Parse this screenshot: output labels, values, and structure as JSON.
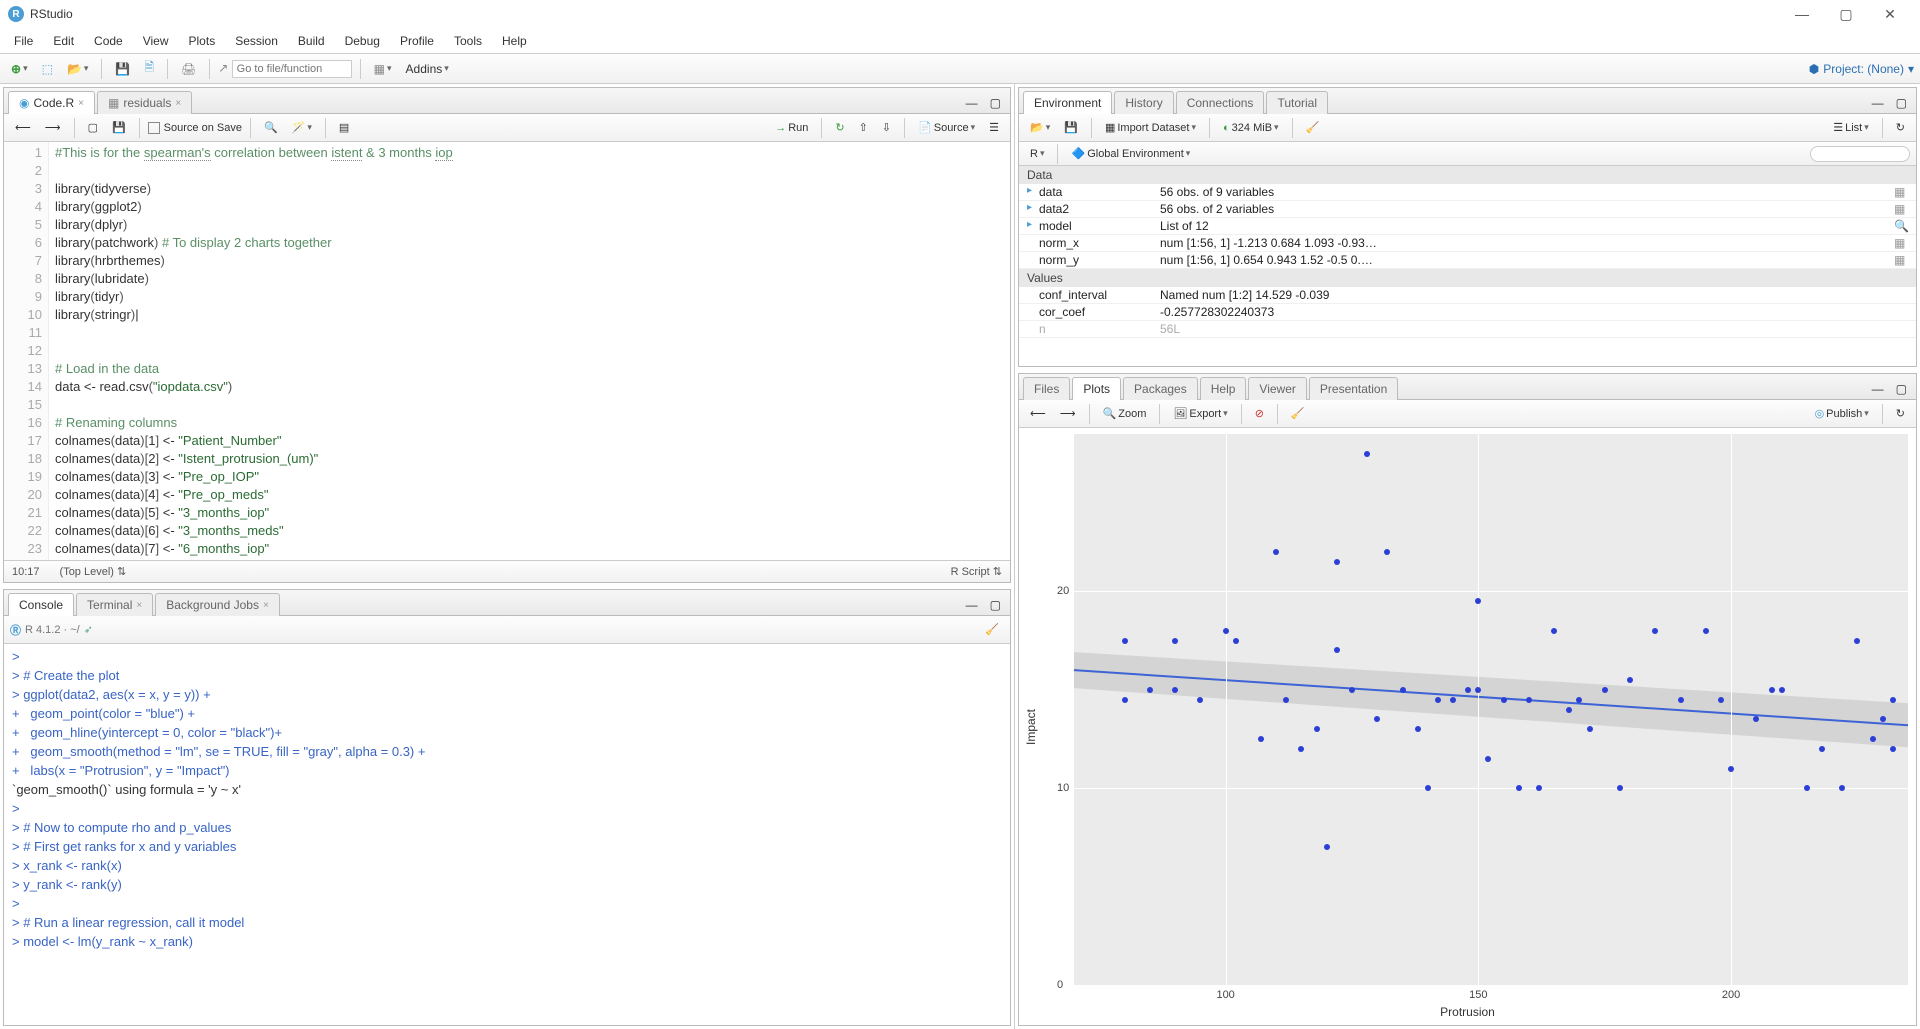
{
  "window": {
    "title": "RStudio"
  },
  "menubar": [
    "File",
    "Edit",
    "Code",
    "View",
    "Plots",
    "Session",
    "Build",
    "Debug",
    "Profile",
    "Tools",
    "Help"
  ],
  "toolbar": {
    "goto_placeholder": "Go to file/function",
    "addins_label": "Addins",
    "project_label": "Project: (None)"
  },
  "source": {
    "tabs": [
      {
        "label": "Code.R",
        "icon": "r-script"
      },
      {
        "label": "residuals",
        "icon": "data"
      }
    ],
    "source_on_save": "Source on Save",
    "run_label": "Run",
    "source_label": "Source",
    "cursor_pos": "10:17",
    "scope": "(Top Level)",
    "filetype": "R Script",
    "lines": [
      {
        "n": 1,
        "html": "<span class='cm-comment'>#This is for the <span class='cm-spell'>spearman's</span> correlation between <span class='cm-spell'>istent</span> &amp; 3 months <span class='cm-spell'>iop</span></span>"
      },
      {
        "n": 2,
        "html": ""
      },
      {
        "n": 3,
        "html": "library<span class='cm-paren'>(</span>tidyverse<span class='cm-paren'>)</span>"
      },
      {
        "n": 4,
        "html": "library<span class='cm-paren'>(</span>ggplot2<span class='cm-paren'>)</span>"
      },
      {
        "n": 5,
        "html": "library<span class='cm-paren'>(</span>dplyr<span class='cm-paren'>)</span>"
      },
      {
        "n": 6,
        "html": "library<span class='cm-paren'>(</span>patchwork<span class='cm-paren'>)</span> <span class='cm-comment'># To display 2 charts together</span>"
      },
      {
        "n": 7,
        "html": "library<span class='cm-paren'>(</span>hrbrthemes<span class='cm-paren'>)</span>"
      },
      {
        "n": 8,
        "html": "library<span class='cm-paren'>(</span>lubridate<span class='cm-paren'>)</span>"
      },
      {
        "n": 9,
        "html": "library<span class='cm-paren'>(</span>tidyr<span class='cm-paren'>)</span>"
      },
      {
        "n": 10,
        "html": "library<span class='cm-paren'>(</span>stringr<span class='cm-paren'>)</span>|"
      },
      {
        "n": 11,
        "html": ""
      },
      {
        "n": 12,
        "html": ""
      },
      {
        "n": 13,
        "html": "<span class='cm-comment'># Load in the data</span>"
      },
      {
        "n": 14,
        "html": "data &lt;- read.csv<span class='cm-paren'>(</span><span class='cm-string'>\"iopdata.csv\"</span><span class='cm-paren'>)</span>"
      },
      {
        "n": 15,
        "html": ""
      },
      {
        "n": 16,
        "html": "<span class='cm-comment'># Renaming columns</span>"
      },
      {
        "n": 17,
        "html": "colnames<span class='cm-paren'>(</span>data<span class='cm-paren'>)[</span>1<span class='cm-paren'>]</span> &lt;- <span class='cm-string'>\"Patient_Number\"</span>"
      },
      {
        "n": 18,
        "html": "colnames<span class='cm-paren'>(</span>data<span class='cm-paren'>)[</span>2<span class='cm-paren'>]</span> &lt;- <span class='cm-string'>\"Istent_protrusion_(um)\"</span>"
      },
      {
        "n": 19,
        "html": "colnames<span class='cm-paren'>(</span>data<span class='cm-paren'>)[</span>3<span class='cm-paren'>]</span> &lt;- <span class='cm-string'>\"Pre_op_IOP\"</span>"
      },
      {
        "n": 20,
        "html": "colnames<span class='cm-paren'>(</span>data<span class='cm-paren'>)[</span>4<span class='cm-paren'>]</span> &lt;- <span class='cm-string'>\"Pre_op_meds\"</span>"
      },
      {
        "n": 21,
        "html": "colnames<span class='cm-paren'>(</span>data<span class='cm-paren'>)[</span>5<span class='cm-paren'>]</span> &lt;- <span class='cm-string'>\"3_months_iop\"</span>"
      },
      {
        "n": 22,
        "html": "colnames<span class='cm-paren'>(</span>data<span class='cm-paren'>)[</span>6<span class='cm-paren'>]</span> &lt;- <span class='cm-string'>\"3_months_meds\"</span>"
      },
      {
        "n": 23,
        "html": "colnames<span class='cm-paren'>(</span>data<span class='cm-paren'>)[</span>7<span class='cm-paren'>]</span> &lt;- <span class='cm-string'>\"6_months_iop\"</span>"
      }
    ]
  },
  "console": {
    "tabs": [
      "Console",
      "Terminal",
      "Background Jobs"
    ],
    "prompt_info": "R 4.1.2 · ~/",
    "lines": [
      ">",
      "> # Create the plot",
      "> ggplot(data2, aes(x = x, y = y)) +",
      "+   geom_point(color = \"blue\") +",
      "+   geom_hline(yintercept = 0, color = \"black\")+",
      "+   geom_smooth(method = \"lm\", se = TRUE, fill = \"gray\", alpha = 0.3) +",
      "+   labs(x = \"Protrusion\", y = \"Impact\")",
      "`geom_smooth()` using formula = 'y ~ x'",
      ">",
      "> # Now to compute rho and p_values",
      "> # First get ranks for x and y variables",
      "> x_rank <- rank(x)",
      "> y_rank <- rank(y)",
      ">",
      "> # Run a linear regression, call it model",
      "> model <- lm(y_rank ~ x_rank)"
    ]
  },
  "env": {
    "tabs": [
      "Environment",
      "History",
      "Connections",
      "Tutorial"
    ],
    "import_label": "Import Dataset",
    "mem_label": "324 MiB",
    "list_label": "List",
    "scope_label": "Global Environment",
    "lang_label": "R",
    "search_placeholder": "",
    "sections": [
      {
        "name": "Data",
        "rows": [
          {
            "name": "data",
            "value": "56 obs. of 9 variables",
            "expandable": true,
            "ico": "grid"
          },
          {
            "name": "data2",
            "value": "56 obs. of 2 variables",
            "expandable": true,
            "ico": "grid"
          },
          {
            "name": "model",
            "value": "List of  12",
            "expandable": true,
            "ico": "search"
          },
          {
            "name": "norm_x",
            "value": "num [1:56, 1] -1.213 0.684 1.093 -0.93…",
            "expandable": false,
            "ico": "grid"
          },
          {
            "name": "norm_y",
            "value": "num [1:56, 1] 0.654 0.943 1.52 -0.5 0.…",
            "expandable": false,
            "ico": "grid"
          }
        ]
      },
      {
        "name": "Values",
        "rows": [
          {
            "name": "conf_interval",
            "value": "Named num [1:2] 14.529 -0.039",
            "expandable": false
          },
          {
            "name": "cor_coef",
            "value": "-0.257728302240373",
            "expandable": false
          },
          {
            "name": "n",
            "value": "56L",
            "expandable": false,
            "dim": true
          }
        ]
      }
    ]
  },
  "plot": {
    "tabs": [
      "Files",
      "Plots",
      "Packages",
      "Help",
      "Viewer",
      "Presentation"
    ],
    "zoom_label": "Zoom",
    "export_label": "Export",
    "publish_label": "Publish",
    "xlabel": "Protrusion",
    "ylabel": "Impact",
    "xticks": [
      100,
      150,
      200
    ],
    "yticks": [
      0,
      10,
      20
    ]
  },
  "chart_data": {
    "type": "scatter",
    "title": "",
    "xlabel": "Protrusion",
    "ylabel": "Impact",
    "xlim": [
      70,
      235
    ],
    "ylim": [
      0,
      28
    ],
    "xticks": [
      100,
      150,
      200
    ],
    "yticks": [
      0,
      10,
      20
    ],
    "series": [
      {
        "name": "points",
        "type": "scatter",
        "color": "#2b3fd4",
        "points": [
          [
            80,
            17.5
          ],
          [
            80,
            14.5
          ],
          [
            85,
            15
          ],
          [
            90,
            17.5
          ],
          [
            90,
            15
          ],
          [
            95,
            14.5
          ],
          [
            100,
            18
          ],
          [
            102,
            17.5
          ],
          [
            107,
            12.5
          ],
          [
            110,
            22
          ],
          [
            112,
            14.5
          ],
          [
            115,
            12
          ],
          [
            118,
            13
          ],
          [
            120,
            7
          ],
          [
            122,
            21.5
          ],
          [
            122,
            17
          ],
          [
            125,
            15
          ],
          [
            128,
            27
          ],
          [
            130,
            13.5
          ],
          [
            132,
            22
          ],
          [
            135,
            15
          ],
          [
            138,
            13
          ],
          [
            140,
            10
          ],
          [
            142,
            14.5
          ],
          [
            145,
            14.5
          ],
          [
            148,
            15
          ],
          [
            150,
            19.5
          ],
          [
            150,
            15
          ],
          [
            152,
            11.5
          ],
          [
            155,
            14.5
          ],
          [
            158,
            10
          ],
          [
            160,
            14.5
          ],
          [
            162,
            10
          ],
          [
            165,
            18
          ],
          [
            168,
            14
          ],
          [
            170,
            14.5
          ],
          [
            172,
            13
          ],
          [
            175,
            15
          ],
          [
            178,
            10
          ],
          [
            180,
            15.5
          ],
          [
            185,
            18
          ],
          [
            190,
            14.5
          ],
          [
            195,
            18
          ],
          [
            198,
            14.5
          ],
          [
            200,
            11
          ],
          [
            205,
            13.5
          ],
          [
            208,
            15
          ],
          [
            210,
            15
          ],
          [
            215,
            10
          ],
          [
            218,
            12
          ],
          [
            222,
            10
          ],
          [
            225,
            17.5
          ],
          [
            228,
            12.5
          ],
          [
            230,
            13.5
          ],
          [
            232,
            12
          ],
          [
            232,
            14.5
          ]
        ]
      }
    ],
    "trendline": {
      "type": "linear",
      "start": [
        70,
        16
      ],
      "end": [
        235,
        13.2
      ],
      "se_band": true
    }
  }
}
